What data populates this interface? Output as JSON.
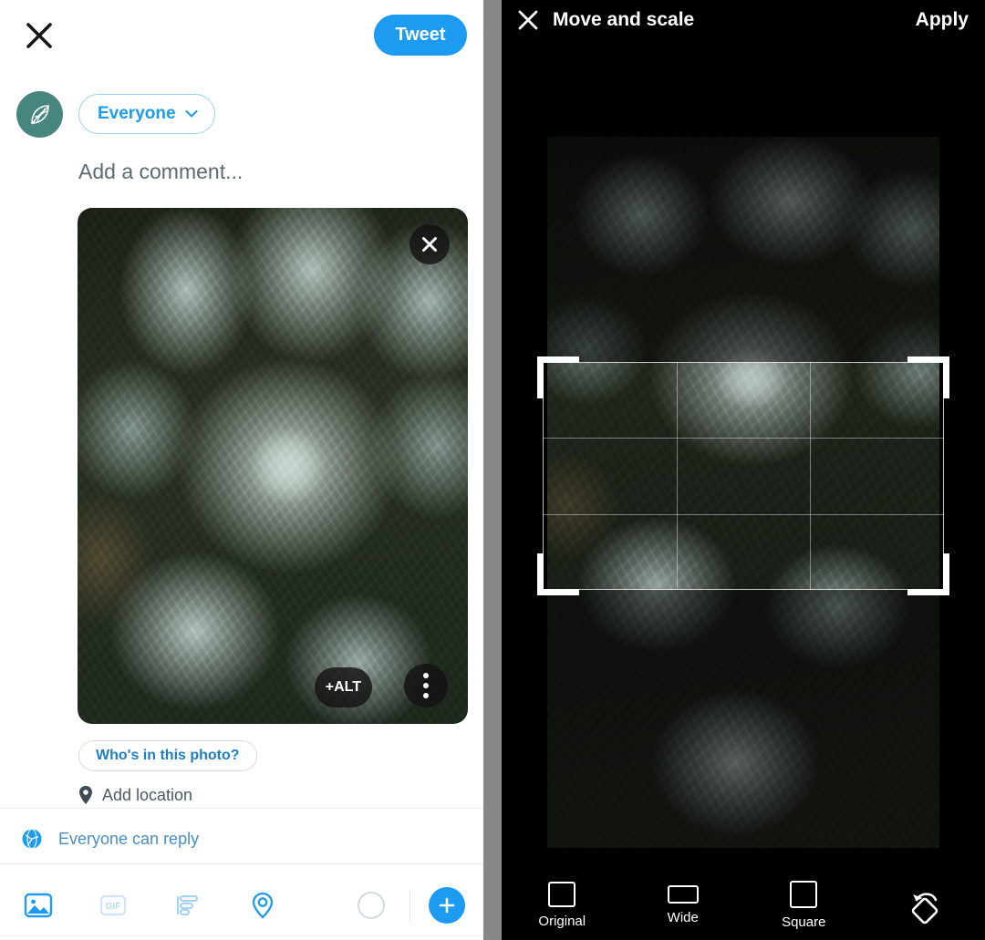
{
  "compose": {
    "close_icon": "close-icon",
    "tweet_button": "Tweet",
    "avatar_icon": "leaf-avatar-icon",
    "audience": {
      "label": "Everyone",
      "chevron_icon": "chevron-down-icon"
    },
    "comment_placeholder": "Add a comment...",
    "photo": {
      "remove_icon": "close-icon",
      "alt_badge": "+ALT",
      "more_icon": "more-options-icon"
    },
    "tag_photo_button": "Who's in this photo?",
    "add_location": {
      "icon": "location-pin-icon",
      "label": "Add location"
    },
    "reply_setting": {
      "icon": "globe-icon",
      "label": "Everyone can reply"
    },
    "toolbar": [
      {
        "name": "media-icon",
        "label": "Media"
      },
      {
        "name": "gif-icon",
        "label": "GIF"
      },
      {
        "name": "poll-icon",
        "label": "Poll"
      },
      {
        "name": "location-icon",
        "label": "Location"
      },
      {
        "name": "char-count-circle-icon",
        "label": ""
      },
      {
        "name": "add-tweet-icon",
        "label": "+"
      }
    ]
  },
  "editor": {
    "close_icon": "close-icon",
    "title": "Move and scale",
    "apply_button": "Apply",
    "crop_overlay": {
      "name": "crop-frame",
      "grid": "rule-of-thirds"
    },
    "ratios": [
      {
        "label": "Original",
        "shape": "original"
      },
      {
        "label": "Wide",
        "shape": "wide"
      },
      {
        "label": "Square",
        "shape": "square"
      }
    ],
    "rotate_icon": "rotate-icon"
  },
  "colors": {
    "twitter_blue": "#1d9bf0",
    "avatar_teal": "#47857f",
    "editor_bg": "#000000",
    "divider_gray": "#878787"
  }
}
